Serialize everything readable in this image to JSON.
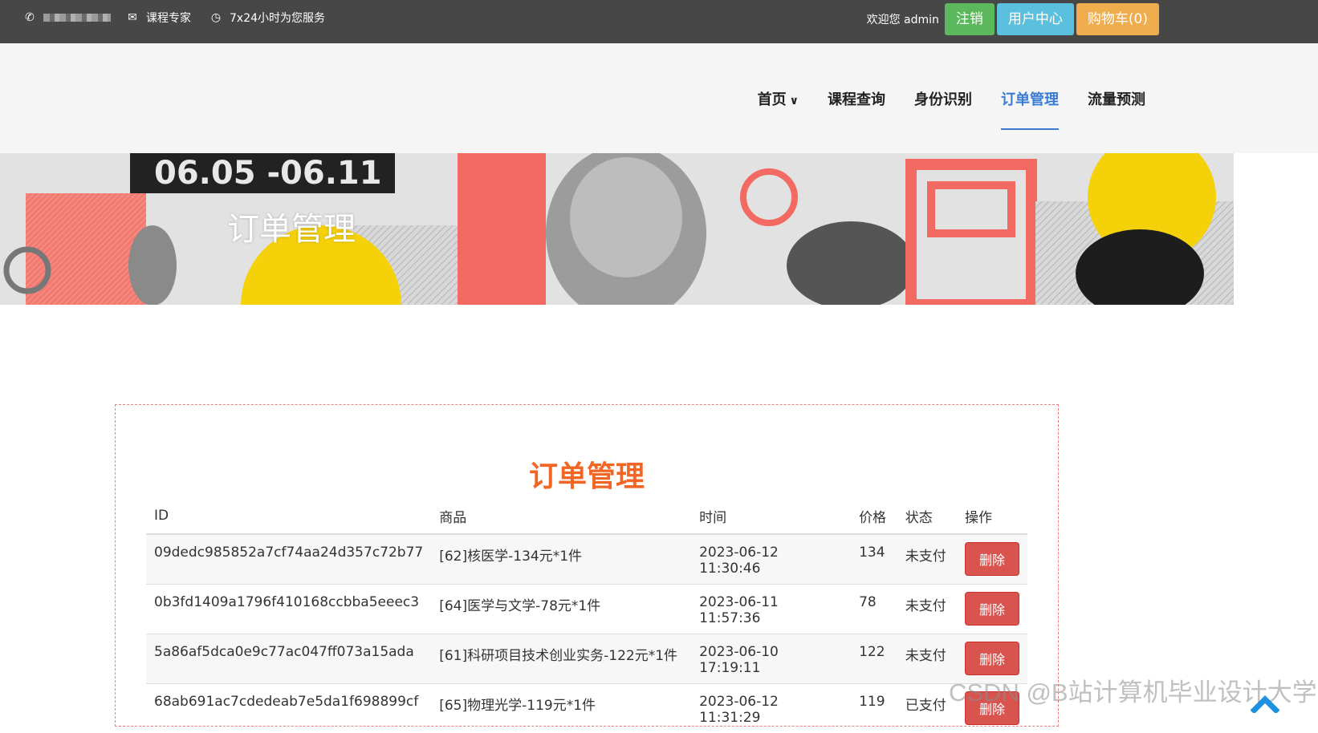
{
  "topbar": {
    "company": "课程专家",
    "service": "7x24小时为您服务",
    "welcome": "欢迎您 admin",
    "logout": "注销",
    "user_center": "用户中心",
    "cart": "购物车(0)"
  },
  "nav": {
    "items": [
      {
        "label": "首页"
      },
      {
        "label": "课程查询"
      },
      {
        "label": "身份识别"
      },
      {
        "label": "订单管理"
      },
      {
        "label": "流量预测"
      }
    ],
    "active_index": 3
  },
  "banner": {
    "title": "订单管理",
    "date_text": "06.05 -06.11"
  },
  "orders": {
    "title": "订单管理",
    "columns": [
      "ID",
      "商品",
      "时间",
      "价格",
      "状态",
      "操作"
    ],
    "rows": [
      {
        "id": "09dedc985852a7cf74aa24d357c72b77",
        "product": "[62]核医学-134元*1件",
        "time": "2023-06-12 11:30:46",
        "price": "134",
        "status": "未支付",
        "action": "删除"
      },
      {
        "id": "0b3fd1409a1796f410168ccbba5eeec3",
        "product": "[64]医学与文学-78元*1件",
        "time": "2023-06-11 11:57:36",
        "price": "78",
        "status": "未支付",
        "action": "删除"
      },
      {
        "id": "5a86af5dca0e9c77ac047ff073a15ada",
        "product": "[61]科研项目技术创业实务-122元*1件",
        "time": "2023-06-10 17:19:11",
        "price": "122",
        "status": "未支付",
        "action": "删除"
      },
      {
        "id": "68ab691ac7cdedeab7e5da1f698899cf",
        "product": "[65]物理光学-119元*1件",
        "time": "2023-06-12 11:31:29",
        "price": "119",
        "status": "已支付",
        "action": "删除"
      }
    ]
  },
  "watermark": "CSDN @B站计算机毕业设计大学",
  "colors": {
    "topbar": "#474747",
    "nav_active": "#3a7bd5",
    "title_orange": "#f26522",
    "delete_red": "#d9534f"
  }
}
